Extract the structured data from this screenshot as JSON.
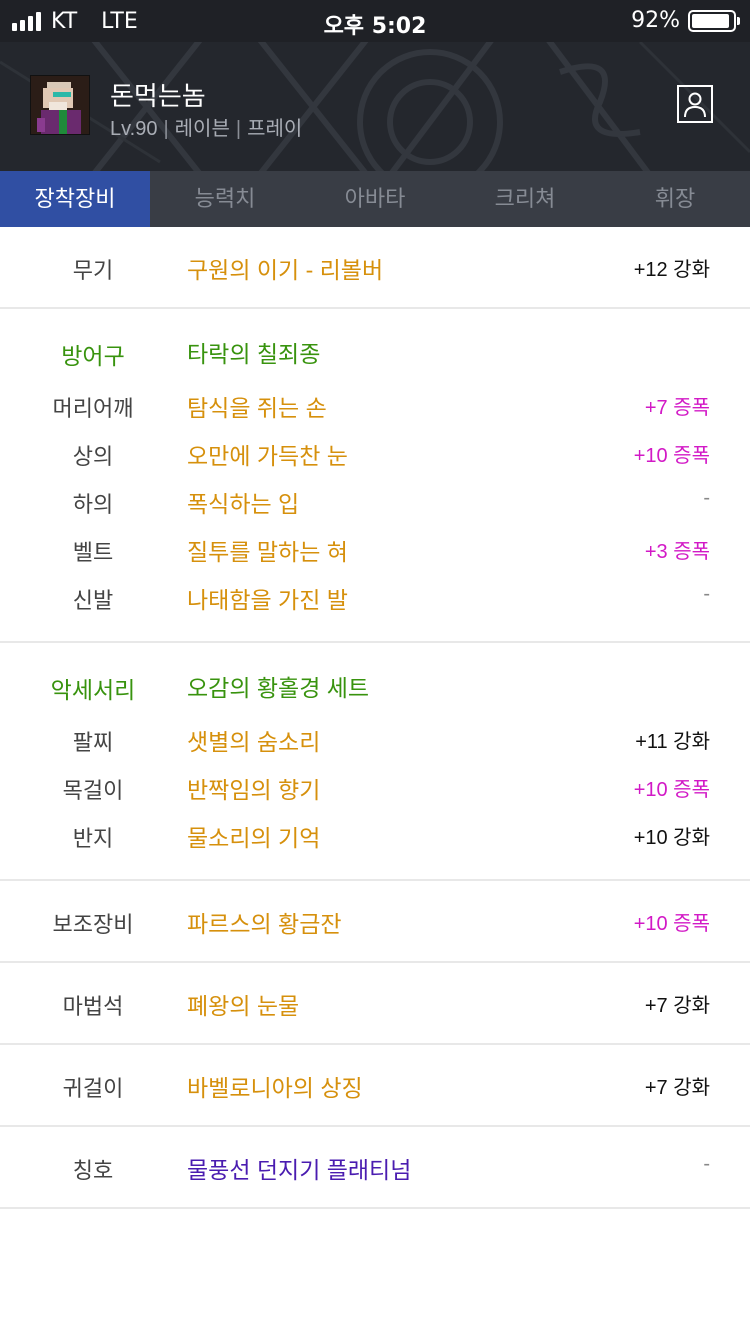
{
  "status_bar": {
    "carrier": "KT",
    "network": "LTE",
    "time": "오후 5:02",
    "battery_percent": "92%",
    "battery_level": 0.92
  },
  "character": {
    "name": "돈먹는놈",
    "level": "Lv.90",
    "job": "레이븐",
    "class": "프레이",
    "avatar_icon": "character-portrait",
    "profile_icon": "person-icon"
  },
  "tabs": [
    {
      "label": "장착장비",
      "active": true
    },
    {
      "label": "능력치",
      "active": false
    },
    {
      "label": "아바타",
      "active": false
    },
    {
      "label": "크리쳐",
      "active": false
    },
    {
      "label": "휘장",
      "active": false
    }
  ],
  "colors": {
    "tab_active": "#304fa3",
    "item_name": "#d6900c",
    "set_name": "#38930e",
    "amplify": "#d219c6",
    "title_item": "#4a1cb0"
  },
  "equipment": {
    "weapon": {
      "label": "무기",
      "name": "구원의 이기 - 리볼버",
      "value": "+12 강화"
    },
    "armor": {
      "label": "방어구",
      "set_name": "타락의 칠죄종",
      "items": [
        {
          "label": "머리어깨",
          "name": "탐식을 쥐는 손",
          "value": "+7 증폭"
        },
        {
          "label": "상의",
          "name": "오만에 가득찬 눈",
          "value": "+10 증폭"
        },
        {
          "label": "하의",
          "name": "폭식하는 입",
          "value": "-"
        },
        {
          "label": "벨트",
          "name": "질투를 말하는 혀",
          "value": "+3 증폭"
        },
        {
          "label": "신발",
          "name": "나태함을 가진 발",
          "value": "-"
        }
      ]
    },
    "accessory": {
      "label": "악세서리",
      "set_name": "오감의 황홀경 세트",
      "items": [
        {
          "label": "팔찌",
          "name": "샛별의 숨소리",
          "value": "+11 강화"
        },
        {
          "label": "목걸이",
          "name": "반짝임의 향기",
          "value": "+10 증폭"
        },
        {
          "label": "반지",
          "name": "물소리의 기억",
          "value": "+10 강화"
        }
      ]
    },
    "sub_equipment": {
      "label": "보조장비",
      "name": "파르스의 황금잔",
      "value": "+10 증폭"
    },
    "magic_stone": {
      "label": "마법석",
      "name": "폐왕의 눈물",
      "value": "+7 강화"
    },
    "earring": {
      "label": "귀걸이",
      "name": "바벨로니아의 상징",
      "value": "+7 강화"
    },
    "title": {
      "label": "칭호",
      "name": "물풍선 던지기 플래티넘",
      "value": "-"
    }
  }
}
